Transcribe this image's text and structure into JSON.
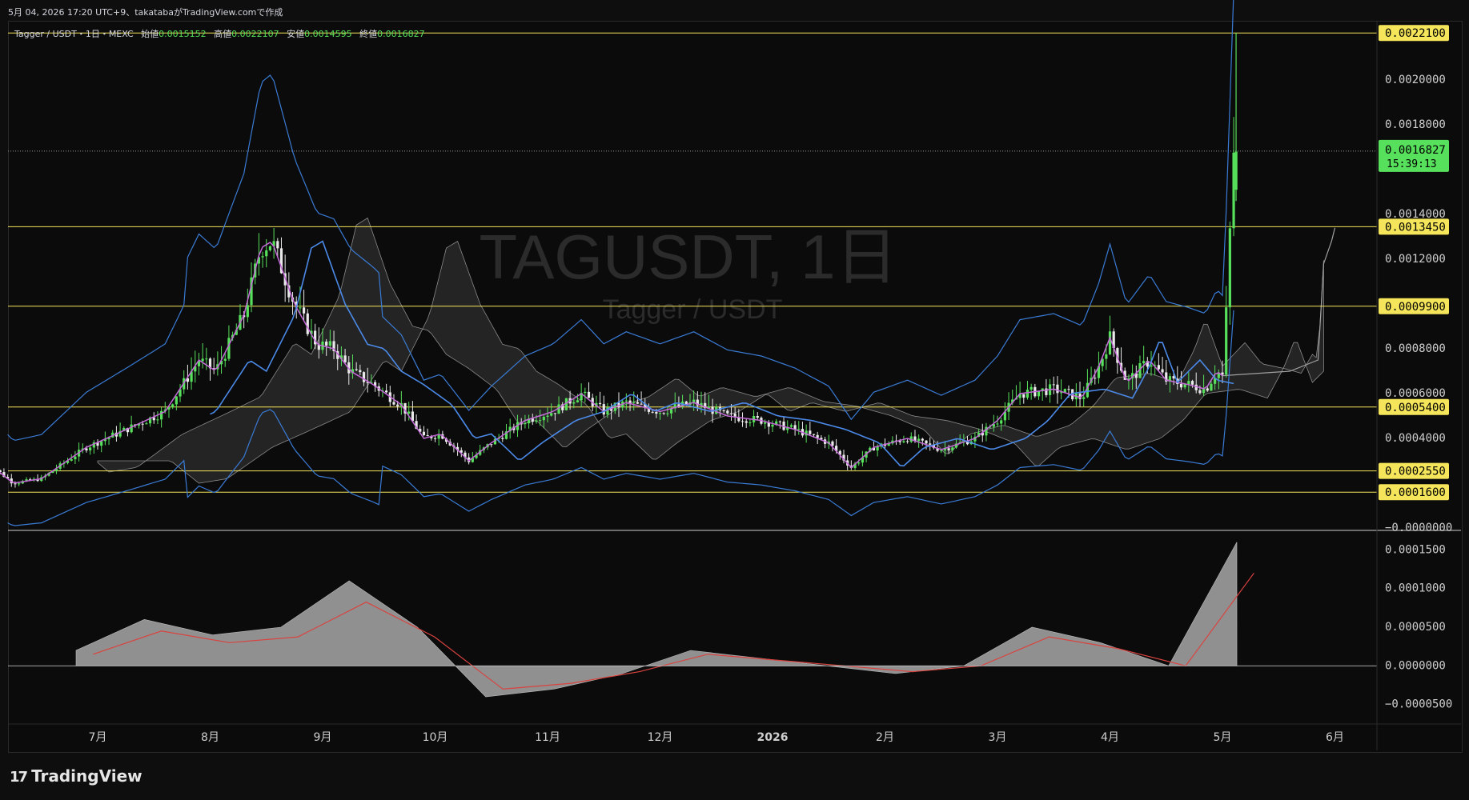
{
  "header": {
    "caption": "5月 04, 2026 17:20 UTC+9、takatabaがTradingView.comで作成"
  },
  "legend": {
    "symbol": "Tagger / USDT・1日・MEXC",
    "open_label": "始値",
    "open": "0.0015152",
    "high_label": "高値",
    "high": "0.0022107",
    "low_label": "安値",
    "low": "0.0014595",
    "close_label": "終値",
    "close": "0.0016827"
  },
  "watermark": {
    "title": "TAGUSDT, 1日",
    "subtitle": "Tagger / USDT"
  },
  "footer": {
    "logo": "TradingView",
    "logo_mark": "17"
  },
  "colors": {
    "background": "#0b0b0b",
    "up": "#57e05b",
    "down": "#e9e9e9",
    "bollinger": "#3a7bd5",
    "ma_fast": "#c46ad8",
    "ma_slow": "#4b8ae8",
    "hline": "#f5e55a",
    "macd_hist": "#9e9e9e",
    "macd_signal": "#d9433f",
    "last_price_tag": "#57e05b"
  },
  "chart_data": [
    {
      "type": "candlestick",
      "title": "TAGUSDT, 1日",
      "symbol": "Tagger / USDT",
      "x_ticks": [
        "7月",
        "8月",
        "9月",
        "10月",
        "11月",
        "12月",
        "2026",
        "2月",
        "3月",
        "4月",
        "5月",
        "6月"
      ],
      "y_ticks": [
        "0.0020000",
        "0.0018000",
        "0.0014000",
        "0.0012000",
        "0.0008000",
        "0.0006000",
        "0.0004000",
        "−0.0000000"
      ],
      "ylim": [
        0.0,
        0.00225
      ],
      "horizontal_levels": [
        "0.0022100",
        "0.0013450",
        "0.0009900",
        "0.0005400",
        "0.0002550",
        "0.0001600"
      ],
      "last_price": {
        "value": "0.0016827",
        "countdown": "15:39:13"
      },
      "monthly_close_approx": [
        {
          "month": "6月",
          "value": 0.00022
        },
        {
          "month": "7月",
          "value": 0.00045
        },
        {
          "month": "8月",
          "value": 0.00125
        },
        {
          "month": "9月",
          "value": 0.00075
        },
        {
          "month": "10月",
          "value": 0.00028
        },
        {
          "month": "11月",
          "value": 0.00055
        },
        {
          "month": "12月",
          "value": 0.0005
        },
        {
          "month": "2026",
          "value": 0.00044
        },
        {
          "month": "2月",
          "value": 0.0003
        },
        {
          "month": "3月",
          "value": 0.00042
        },
        {
          "month": "4月",
          "value": 0.00065
        },
        {
          "month": "5月",
          "value": 0.00168
        }
      ]
    },
    {
      "type": "area",
      "title": "",
      "y_ticks": [
        "0.0001500",
        "0.0001000",
        "0.0000500",
        "0.0000000",
        "−0.0000500"
      ],
      "ylim": [
        -7e-05,
        0.00017
      ],
      "series": [
        {
          "name": "",
          "values": [
            2e-05,
            6e-05,
            4e-05,
            5e-05,
            0.00011,
            5e-05,
            -4e-05,
            -3e-05,
            -1e-05,
            2e-05,
            1e-05,
            0.0,
            -1e-05,
            0.0,
            5e-05,
            3e-05,
            0.0,
            0.00016
          ]
        }
      ]
    }
  ]
}
